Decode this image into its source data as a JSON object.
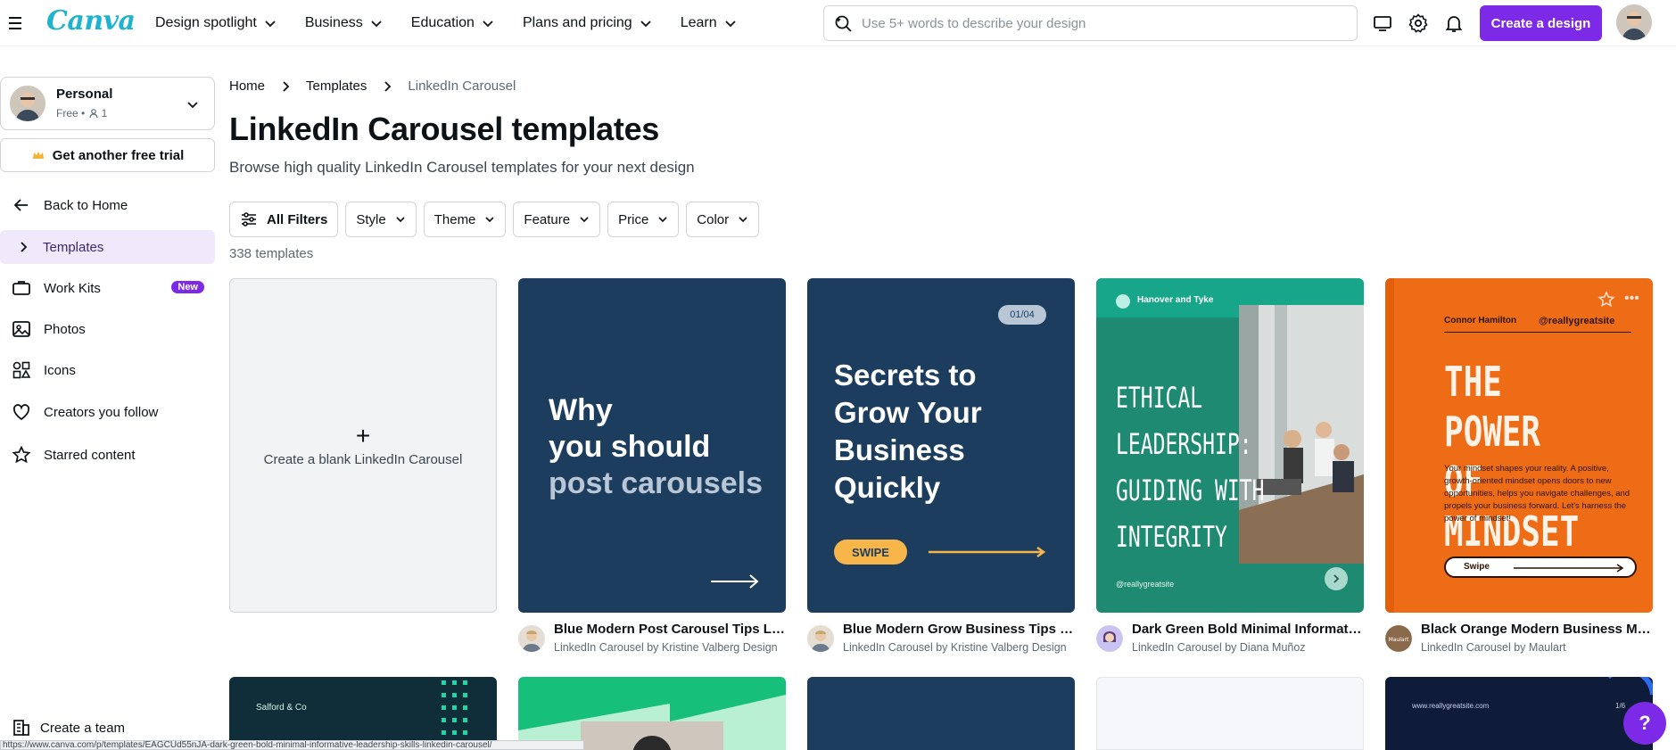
{
  "app": {
    "logo": "Canva"
  },
  "topnav": {
    "items": [
      {
        "label": "Design spotlight"
      },
      {
        "label": "Business"
      },
      {
        "label": "Education"
      },
      {
        "label": "Plans and pricing"
      },
      {
        "label": "Learn"
      }
    ],
    "search_placeholder": "Use 5+ words to describe your design",
    "create_label": "Create a design"
  },
  "sidebar": {
    "account": {
      "name": "Personal",
      "plan": "Free",
      "members": "1"
    },
    "trial_label": "Get another free trial",
    "items": [
      {
        "label": "Back to Home",
        "icon": "arrow-left-icon"
      },
      {
        "label": "Templates",
        "icon": "chevron-right-icon"
      },
      {
        "label": "Work Kits",
        "icon": "work-kits-icon",
        "badge": "New"
      },
      {
        "label": "Photos",
        "icon": "photo-icon"
      },
      {
        "label": "Icons",
        "icon": "shapes-icon"
      },
      {
        "label": "Creators you follow",
        "icon": "heart-icon"
      },
      {
        "label": "Starred content",
        "icon": "star-icon"
      }
    ],
    "team_label": "Create a team"
  },
  "breadcrumb": [
    "Home",
    "Templates",
    "LinkedIn Carousel"
  ],
  "page": {
    "title": "LinkedIn Carousel templates",
    "description": "Browse high quality LinkedIn Carousel templates for your next design",
    "count": "338 templates"
  },
  "filters": [
    "All Filters",
    "Style",
    "Theme",
    "Feature",
    "Price",
    "Color"
  ],
  "blank_card": {
    "label": "Create a blank LinkedIn Carousel"
  },
  "templates": [
    {
      "title": "Blue Modern Post Carousel Tips Link…",
      "subtitle": "LinkedIn Carousel by Kristine Valberg Design",
      "thumb": {
        "lines": [
          "Why",
          "you should",
          "post carousels"
        ]
      }
    },
    {
      "title": "Blue Modern Grow Business Tips Lin…",
      "subtitle": "LinkedIn Carousel by Kristine Valberg Design",
      "thumb": {
        "page": "01/04",
        "lines": [
          "Secrets to",
          "Grow Your",
          "Business",
          "Quickly"
        ],
        "button": "SWIPE"
      }
    },
    {
      "title": "Dark Green Bold Minimal Informativ…",
      "subtitle": "LinkedIn Carousel by Diana Muñoz",
      "thumb": {
        "brand": "Hanover and Tyke",
        "lines": [
          "ETHICAL",
          "LEADERSHIP:",
          "GUIDING WITH",
          "INTEGRITY"
        ],
        "handle": "@reallygreatsite"
      }
    },
    {
      "title": "Black Orange Modern Business Mind…",
      "subtitle": "LinkedIn Carousel by Maulart",
      "thumb": {
        "name": "Connor Hamilton",
        "handle": "@reallygreatsite",
        "lines": [
          "THE POWER",
          "OF MINDSET"
        ],
        "body": "Your mindset shapes your reality. A positive, growth-oriented mindset opens doors to new opportunities, helps you navigate challenges, and propels your business forward. Let's harness the power of mindset!",
        "button": "Swipe"
      }
    }
  ],
  "row2": [
    {
      "brand": "Salford & Co"
    },
    {},
    {},
    {},
    {
      "url": "www.reallygreatsite.com",
      "page": "1/6"
    }
  ],
  "statusbar": "https://www.canva.com/p/templates/EAGCUd55nJA-dark-green-bold-minimal-informative-leadership-skills-linkedin-carousel/",
  "help_label": "?",
  "colors": {
    "accent": "#7d2ae8",
    "logo": "#1fb3cf",
    "navy": "#1c3d5e",
    "green": "#1f8a72",
    "orange": "#ef6c17"
  }
}
